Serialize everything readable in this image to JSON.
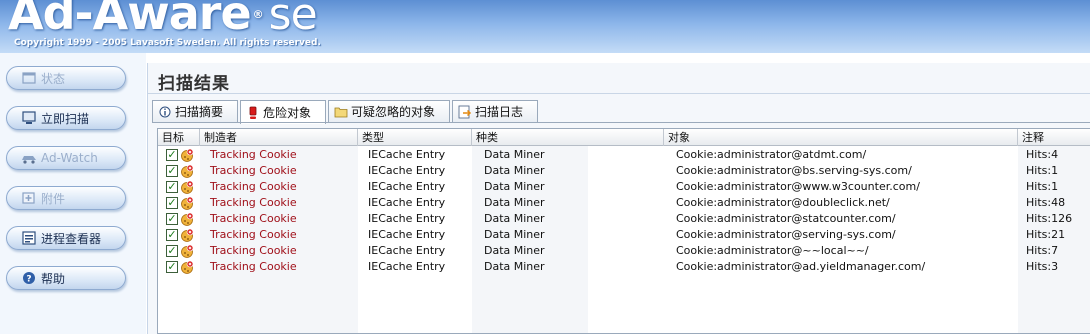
{
  "header": {
    "logo_text": "Ad-Aware",
    "logo_edition": "se",
    "registered_mark": "®",
    "copyright": "Copyright 1999 - 2005 Lavasoft Sweden. All rights reserved."
  },
  "sidebar": {
    "items": [
      {
        "label": "状态",
        "icon": "status-window-icon",
        "disabled": true
      },
      {
        "label": "立即扫描",
        "icon": "scan-monitor-icon",
        "disabled": false
      },
      {
        "label": "Ad-Watch",
        "icon": "ad-watch-car-icon",
        "disabled": true
      },
      {
        "label": "附件",
        "icon": "plugin-plus-icon",
        "disabled": true
      },
      {
        "label": "进程查看器",
        "icon": "process-viewer-icon",
        "disabled": false
      },
      {
        "label": "帮助",
        "icon": "help-question-icon",
        "disabled": false
      }
    ]
  },
  "main": {
    "title": "扫描结果",
    "tabs": [
      {
        "label": "扫描摘要",
        "icon": "info-icon"
      },
      {
        "label": "危险对象",
        "icon": "red-alert-icon",
        "active": true
      },
      {
        "label": "可疑忽略的对象",
        "icon": "folder-icon"
      },
      {
        "label": "扫描日志",
        "icon": "log-arrow-icon"
      }
    ]
  },
  "table": {
    "columns": [
      "目标",
      "制造者",
      "类型",
      "种类",
      "对象",
      "注释"
    ],
    "rows": [
      {
        "checked": true,
        "maker": "Tracking Cookie",
        "type": "IECache Entry",
        "category": "Data Miner",
        "object": "Cookie:administrator@atdmt.com/",
        "comment": "Hits:4"
      },
      {
        "checked": true,
        "maker": "Tracking Cookie",
        "type": "IECache Entry",
        "category": "Data Miner",
        "object": "Cookie:administrator@bs.serving-sys.com/",
        "comment": "Hits:1"
      },
      {
        "checked": true,
        "maker": "Tracking Cookie",
        "type": "IECache Entry",
        "category": "Data Miner",
        "object": "Cookie:administrator@www.w3counter.com/",
        "comment": "Hits:1"
      },
      {
        "checked": true,
        "maker": "Tracking Cookie",
        "type": "IECache Entry",
        "category": "Data Miner",
        "object": "Cookie:administrator@doubleclick.net/",
        "comment": "Hits:48"
      },
      {
        "checked": true,
        "maker": "Tracking Cookie",
        "type": "IECache Entry",
        "category": "Data Miner",
        "object": "Cookie:administrator@statcounter.com/",
        "comment": "Hits:126"
      },
      {
        "checked": true,
        "maker": "Tracking Cookie",
        "type": "IECache Entry",
        "category": "Data Miner",
        "object": "Cookie:administrator@serving-sys.com/",
        "comment": "Hits:21"
      },
      {
        "checked": true,
        "maker": "Tracking Cookie",
        "type": "IECache Entry",
        "category": "Data Miner",
        "object": "Cookie:administrator@~~local~~/",
        "comment": "Hits:7"
      },
      {
        "checked": true,
        "maker": "Tracking Cookie",
        "type": "IECache Entry",
        "category": "Data Miner",
        "object": "Cookie:administrator@ad.yieldmanager.com/",
        "comment": "Hits:3"
      }
    ]
  },
  "colors": {
    "maker_text": "#a0101a",
    "banner_top": "#5d8fd3",
    "check_green": "#1b7a1b"
  }
}
